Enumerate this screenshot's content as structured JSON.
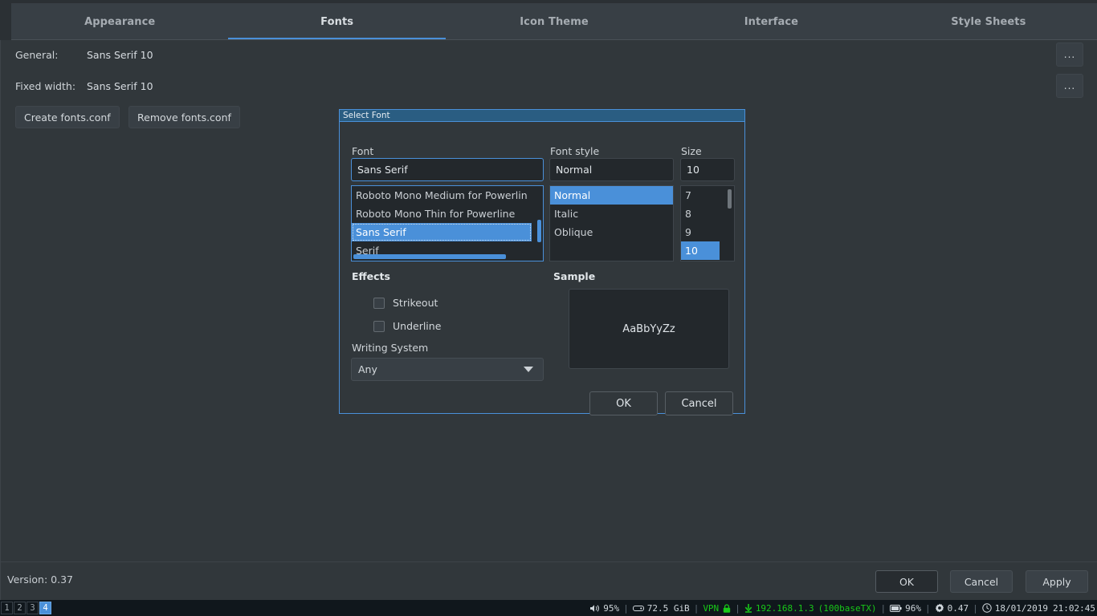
{
  "app": {
    "tabs": [
      {
        "label": "Appearance",
        "active": false
      },
      {
        "label": "Fonts",
        "active": true
      },
      {
        "label": "Icon Theme",
        "active": false
      },
      {
        "label": "Interface",
        "active": false
      },
      {
        "label": "Style Sheets",
        "active": false
      }
    ],
    "fonts_page": {
      "general_label": "General:",
      "general_value": "Sans Serif 10",
      "general_browse": "...",
      "fixed_label": "Fixed width:",
      "fixed_value": "Sans Serif 10",
      "fixed_browse": "...",
      "create_conf": "Create  fonts.conf",
      "remove_conf": "Remove fonts.conf"
    },
    "bottom": {
      "version": "Version: 0.37",
      "ok": "OK",
      "cancel": "Cancel",
      "apply": "Apply"
    }
  },
  "dialog": {
    "title": "Select Font",
    "font": {
      "label": "Font",
      "value": "Sans Serif",
      "items": [
        {
          "label": "Roboto Mono Medium for Powerlin",
          "selected": false
        },
        {
          "label": "Roboto Mono Thin for Powerline",
          "selected": false
        },
        {
          "label": "Sans Serif",
          "selected": true
        },
        {
          "label": "Serif",
          "selected": false
        }
      ]
    },
    "style": {
      "label": "Font style",
      "value": "Normal",
      "items": [
        {
          "label": "Normal",
          "selected": true
        },
        {
          "label": "Italic",
          "selected": false
        },
        {
          "label": "Oblique",
          "selected": false
        }
      ]
    },
    "size": {
      "label": "Size",
      "value": "10",
      "items": [
        {
          "label": "7",
          "selected": false
        },
        {
          "label": "8",
          "selected": false
        },
        {
          "label": "9",
          "selected": false
        },
        {
          "label": "10",
          "selected": true
        }
      ]
    },
    "effects": {
      "label": "Effects",
      "strikeout": "Strikeout",
      "underline": "Underline"
    },
    "writing_system": {
      "label": "Writing System",
      "value": "Any"
    },
    "sample": {
      "label": "Sample",
      "text": "AaBbYyZz"
    },
    "buttons": {
      "ok": "OK",
      "cancel": "Cancel"
    }
  },
  "taskbar": {
    "workspaces": [
      {
        "label": "1",
        "active": false
      },
      {
        "label": "2",
        "active": false
      },
      {
        "label": "3",
        "active": false
      },
      {
        "label": "4",
        "active": true
      }
    ],
    "tray": {
      "volume": "95%",
      "disk": "72.5 GiB",
      "vpn_label": "VPN",
      "ip": "192.168.1.3",
      "net_type": "(100baseTX)",
      "battery": "96%",
      "load": "0.47",
      "date": "18/01/2019",
      "time": "21:02:45",
      "separator": "|"
    }
  },
  "colors": {
    "accent": "#4a90d9",
    "titlebar": "#2a5d82",
    "window_bg": "#31373b",
    "field_bg": "#23282c",
    "taskbar_bg": "#10171c",
    "tray_green": "#18c818"
  }
}
